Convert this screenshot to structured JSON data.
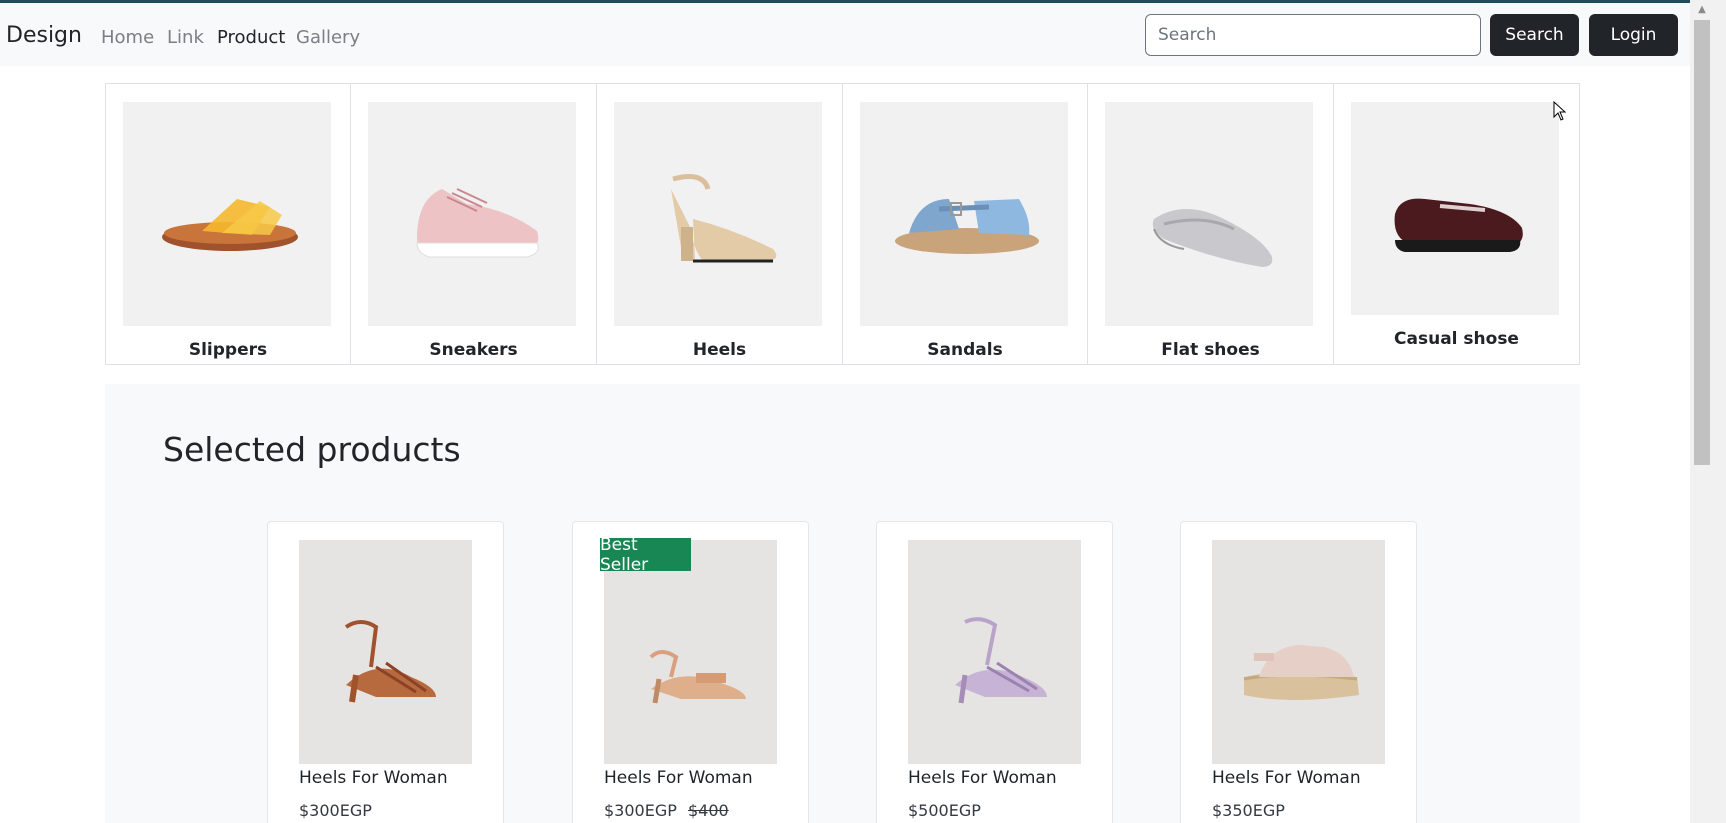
{
  "navbar": {
    "brand": "Design",
    "links": [
      "Home",
      "Link",
      "Product",
      "Gallery"
    ],
    "active_link": "Product",
    "search_placeholder": "Search",
    "search_button": "Search",
    "login_button": "Login"
  },
  "categories": [
    {
      "label": "Slippers",
      "icon": "slipper-image"
    },
    {
      "label": "Sneakers",
      "icon": "sneaker-image"
    },
    {
      "label": "Heels",
      "icon": "heel-image"
    },
    {
      "label": "Sandals",
      "icon": "sandal-image"
    },
    {
      "label": "Flat shoes",
      "icon": "flat-shoe-image"
    },
    {
      "label": "Casual shose",
      "icon": "loafer-image"
    }
  ],
  "selected": {
    "title": "Selected products",
    "products": [
      {
        "name": "Heels For Woman",
        "price": "$300EGP",
        "old_price": "",
        "badge": ""
      },
      {
        "name": "Heels For Woman",
        "price": "$300EGP",
        "old_price": "$400",
        "badge": "Best Seller"
      },
      {
        "name": "Heels For Woman",
        "price": "$500EGP",
        "old_price": "",
        "badge": ""
      },
      {
        "name": "Heels For Woman",
        "price": "$350EGP",
        "old_price": "",
        "badge": ""
      }
    ]
  },
  "colors": {
    "navbar_bg": "#f8f9fa",
    "button_dark": "#212529",
    "badge_green": "#198754"
  }
}
